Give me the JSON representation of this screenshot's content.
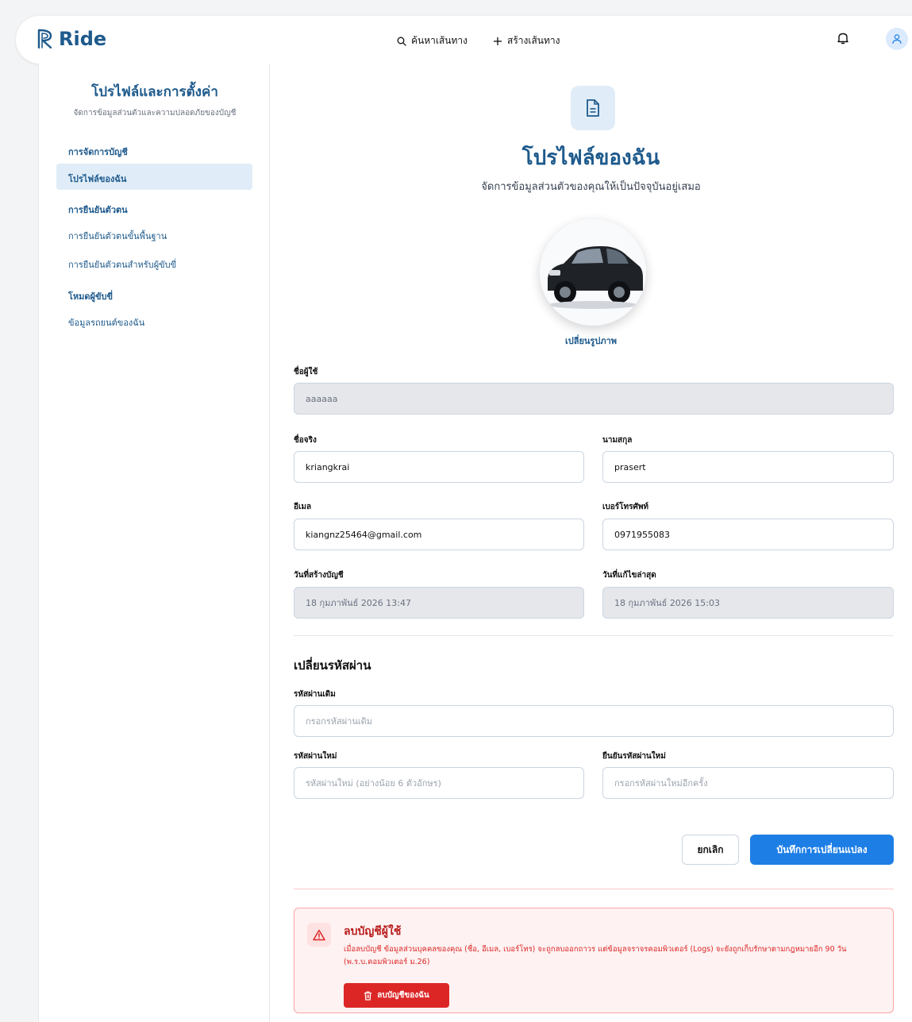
{
  "nav": {
    "brand": "Ride",
    "search_label": "ค้นหาเส้นทาง",
    "create_label": "สร้างเส้นทาง"
  },
  "sidebar": {
    "title": "โปรไฟล์และการตั้งค่า",
    "subtitle": "จัดการข้อมูลส่วนตัวและความปลอดภัยของบัญชี",
    "sections": [
      {
        "label": "การจัดการบัญชี",
        "items": [
          "โปรไฟล์ของฉัน"
        ]
      },
      {
        "label": "การยืนยันตัวตน",
        "items": [
          "การยืนยันตัวตนขั้นพื้นฐาน",
          "การยืนยันตัวตนสำหรับผู้ขับขี่"
        ]
      },
      {
        "label": "โหมดผู้ขับขี่",
        "items": [
          "ข้อมูลรถยนต์ของฉัน"
        ]
      }
    ]
  },
  "main": {
    "title": "โปรไฟล์ของฉัน",
    "subtitle": "จัดการข้อมูลส่วนตัวของคุณให้เป็นปัจจุบันอยู่เสมอ",
    "change_photo": "เปลี่ยนรูปภาพ",
    "fields": {
      "username": {
        "label": "ชื่อผู้ใช้",
        "value": "aaaaaa"
      },
      "first_name": {
        "label": "ชื่อจริง",
        "value": "kriangkrai"
      },
      "last_name": {
        "label": "นามสกุล",
        "value": "prasert"
      },
      "email": {
        "label": "อีเมล",
        "value": "kiangnz25464@gmail.com"
      },
      "phone": {
        "label": "เบอร์โทรศัพท์",
        "value": "0971955083"
      },
      "created": {
        "label": "วันที่สร้างบัญชี",
        "value": "18 กุมภาพันธ์ 2026 13:47"
      },
      "updated": {
        "label": "วันที่แก้ไขล่าสุด",
        "value": "18 กุมภาพันธ์ 2026 15:03"
      }
    },
    "password": {
      "title": "เปลี่ยนรหัสผ่าน",
      "current_label": "รหัสผ่านเดิม",
      "current_placeholder": "กรอกรหัสผ่านเดิม",
      "new_label": "รหัสผ่านใหม่",
      "new_placeholder": "รหัสผ่านใหม่ (อย่างน้อย 6 ตัวอักษร)",
      "confirm_label": "ยืนยันรหัสผ่านใหม่",
      "confirm_placeholder": "กรอกรหัสผ่านใหม่อีกครั้ง"
    },
    "buttons": {
      "cancel": "ยกเลิก",
      "save": "บันทึกการเปลี่ยนแปลง"
    },
    "danger": {
      "title": "ลบบัญชีผู้ใช้",
      "text": "เมื่อลบบัญชี ข้อมูลส่วนบุคคลของคุณ (ชื่อ, อีเมล, เบอร์โทร) จะถูกลบออกถาวร แต่ข้อมูลจราจรคอมพิวเตอร์ (Logs) จะยังถูกเก็บรักษาตามกฎหมายอีก 90 วัน (พ.ร.บ.คอมพิวเตอร์ ม.26)",
      "button": "ลบบัญชีของฉัน"
    }
  },
  "colors": {
    "brand": "#1e5a8c",
    "primary_button": "#1d7ee6",
    "danger": "#dc2626"
  }
}
